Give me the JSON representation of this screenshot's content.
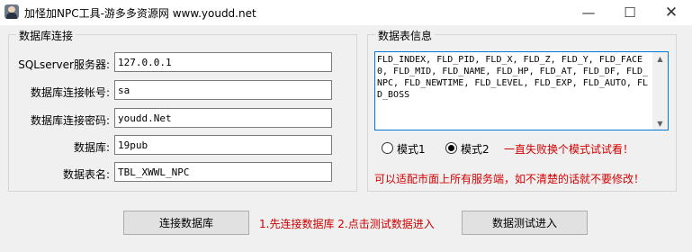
{
  "window": {
    "title": "加怪加NPC工具-游多多资源网 www.youdd.net",
    "min_glyph": "—",
    "max_glyph": "☐",
    "close_glyph": "✕",
    "icon": "app-portrait-icon"
  },
  "db_group": {
    "title": "数据库连接",
    "fields": [
      {
        "label": "SQLserver服务器:",
        "value": "127.0.0.1"
      },
      {
        "label": "数据库连接帐号:",
        "value": "sa"
      },
      {
        "label": "数据库连接密码:",
        "value": "youdd.Net"
      },
      {
        "label": "数据库:",
        "value": "19pub"
      },
      {
        "label": "数据表名:",
        "value": "TBL_XWWL_NPC"
      }
    ]
  },
  "table_group": {
    "title": "数据表信息",
    "columns_text": "FLD_INDEX, FLD_PID, FLD_X, FLD_Z, FLD_Y, FLD_FACE0, FLD_MID, FLD_NAME, FLD_HP, FLD_AT, FLD_DF, FLD_NPC, FLD_NEWTIME, FLD_LEVEL, FLD_EXP, FLD_AUTO, FLD_BOSS",
    "scroll_up": "▲",
    "scroll_down": "▼",
    "mode1_label": "模式1",
    "mode2_label": "模式2",
    "selected_mode": 2,
    "mode_hint": "一直失败换个模式试试看！",
    "compat_note": "可以适配市面上所有服务端，如不清楚的话就不要修改！"
  },
  "footer": {
    "connect_button": "连接数据库",
    "steps_hint": "1.先连接数据库 2.点击测试数据进入",
    "test_button": "数据测试进入"
  },
  "colors": {
    "accent": "#0078d7",
    "warning": "#d40000",
    "background": "#f0f0f0"
  }
}
